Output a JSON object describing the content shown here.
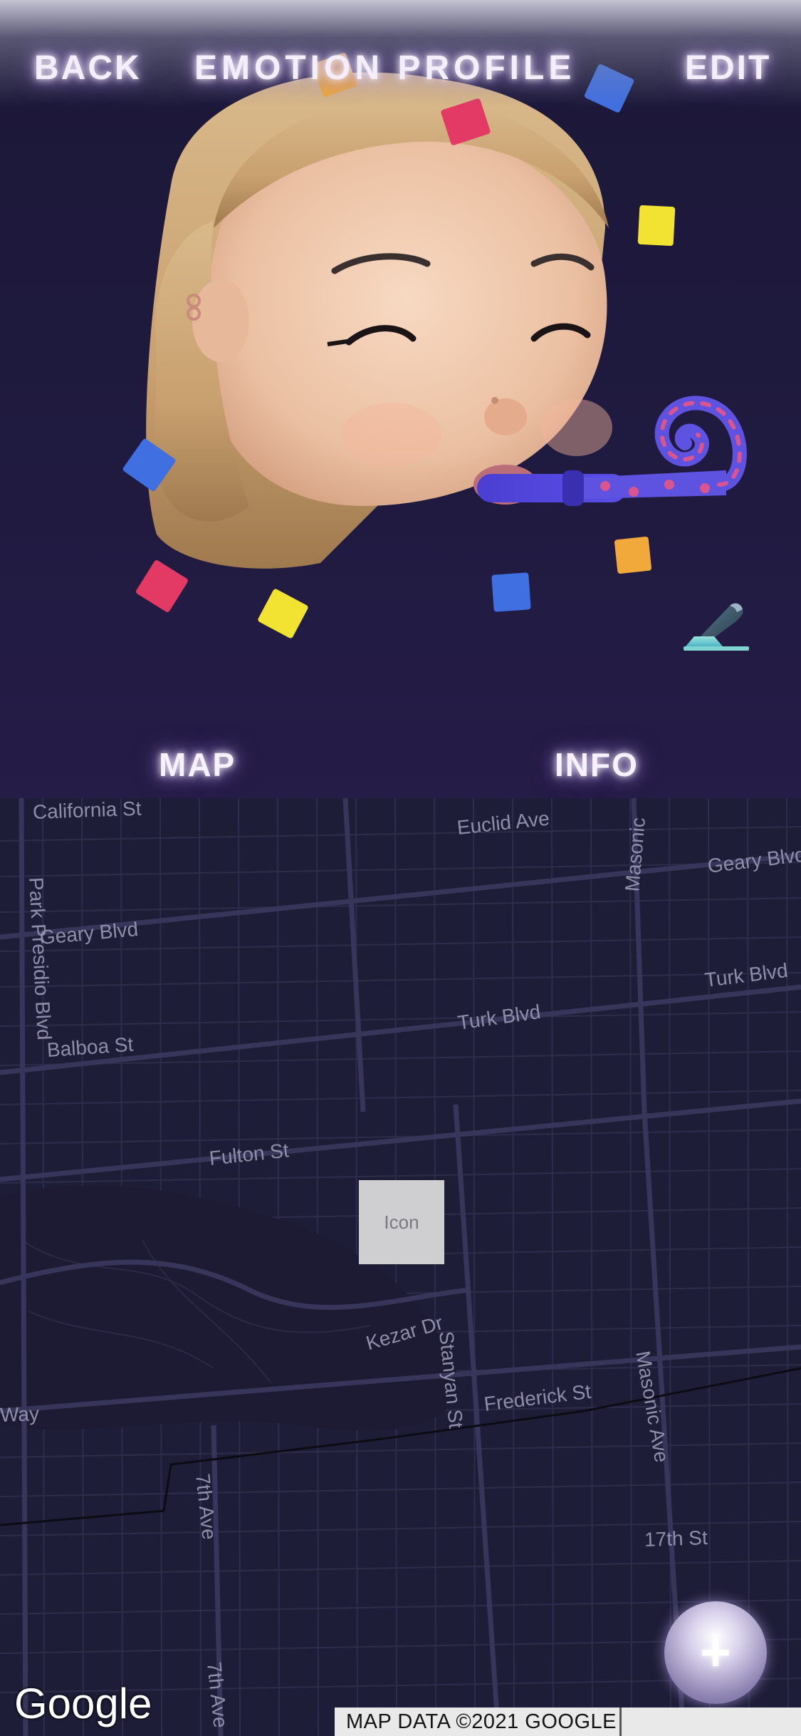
{
  "header": {
    "back_label": "BACK",
    "title": "EMOTION PROFILE",
    "edit_label": "EDIT"
  },
  "hero": {
    "avatar_icon": "memoji-party-avatar",
    "edit_icon": "pencil-icon",
    "map_label": "MAP",
    "info_label": "INFO"
  },
  "map": {
    "streets": [
      "California St",
      "Euclid Ave",
      "Masonic",
      "Geary Blvd",
      "Park Presidio Blvd",
      "Geary Blvd",
      "Turk Blvd",
      "Turk Blvd",
      "Balboa St",
      "Fulton St",
      "Stanyan St",
      "Masonic Ave",
      "Kezar Dr",
      "Frederick St",
      "Way",
      "7th Ave",
      "17th St",
      "7th Ave"
    ],
    "marker_text": "Icon",
    "fab_icon": "plus-icon",
    "fab_label": "+",
    "logo_text": "Google",
    "attribution": "MAP DATA ©2021 GOOGLE"
  },
  "colors": {
    "hero_bg": "#1f1a3f",
    "map_bg": "#1e1d38",
    "glow_text": "#f4eefc"
  }
}
